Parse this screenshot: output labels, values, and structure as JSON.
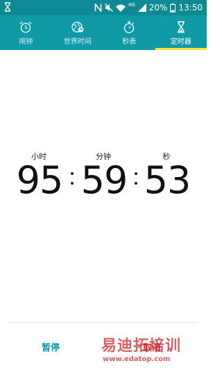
{
  "status_bar": {
    "battery_percent": "20%",
    "time": "13:50",
    "network_type": "4G",
    "icons": [
      "hourglass-icon",
      "nfc-icon",
      "mute-icon",
      "wifi-icon",
      "signal-icon",
      "battery-icon"
    ]
  },
  "tabs": [
    {
      "label": "闹钟",
      "icon": "alarm-clock-icon",
      "active": false
    },
    {
      "label": "世界时间",
      "icon": "globe-clock-icon",
      "active": false
    },
    {
      "label": "秒表",
      "icon": "stopwatch-icon",
      "active": false
    },
    {
      "label": "定时器",
      "icon": "hourglass-icon",
      "active": true
    }
  ],
  "timer": {
    "hours_label": "小时",
    "minutes_label": "分钟",
    "seconds_label": "秒",
    "hours": "95",
    "minutes": "59",
    "seconds": "53"
  },
  "buttons": {
    "pause": "暂停",
    "cancel": "取消"
  },
  "watermark": {
    "text": "易迪拓培训",
    "url": "www.edatop.com"
  },
  "colors": {
    "status_bar": "#0d8a94",
    "tab_bar": "#0f9aa5",
    "active_indicator": "#ffe033",
    "pause": "#0f9aa5",
    "cancel": "#d32f2f"
  }
}
